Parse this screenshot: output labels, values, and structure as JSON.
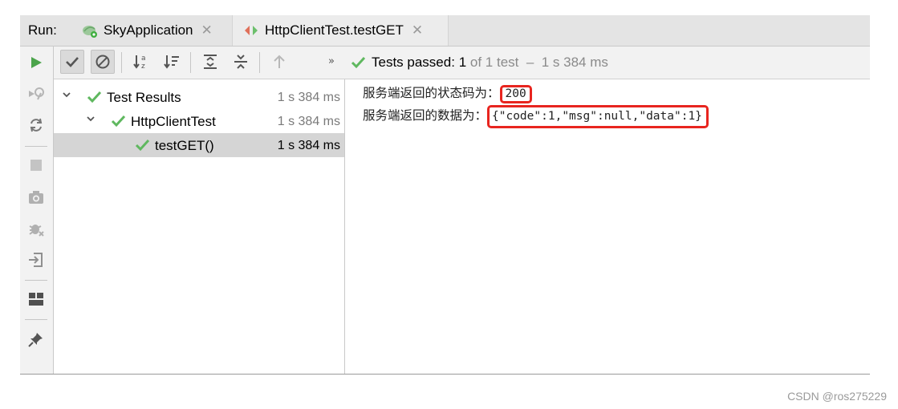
{
  "run_label": "Run:",
  "tabs": [
    {
      "label": "SkyApplication",
      "icon": "spring-boot-icon"
    },
    {
      "label": "HttpClientTest.testGET",
      "icon": "junit-icon"
    }
  ],
  "toolbar": {
    "status_prefix": "Tests passed:",
    "passed_count": "1",
    "of_text": "of 1 test",
    "dash": "–",
    "duration": "1 s 384 ms",
    "more": "»"
  },
  "tree": [
    {
      "label": "Test Results",
      "time": "1 s 384 ms",
      "level": 0,
      "expanded": true
    },
    {
      "label": "HttpClientTest",
      "time": "1 s 384 ms",
      "level": 1,
      "expanded": true
    },
    {
      "label": "testGET()",
      "time": "1 s 384 ms",
      "level": 2,
      "selected": true
    }
  ],
  "console": {
    "line1_label": "服务端返回的状态码为：",
    "line1_value": "200",
    "line2_label": "服务端返回的数据为：",
    "line2_value": "{\"code\":1,\"msg\":null,\"data\":1}"
  },
  "watermark": "CSDN @ros275229",
  "colors": {
    "pass_green": "#5fb85f",
    "highlight_red": "#e8251f",
    "run_green": "#4ba44b"
  }
}
